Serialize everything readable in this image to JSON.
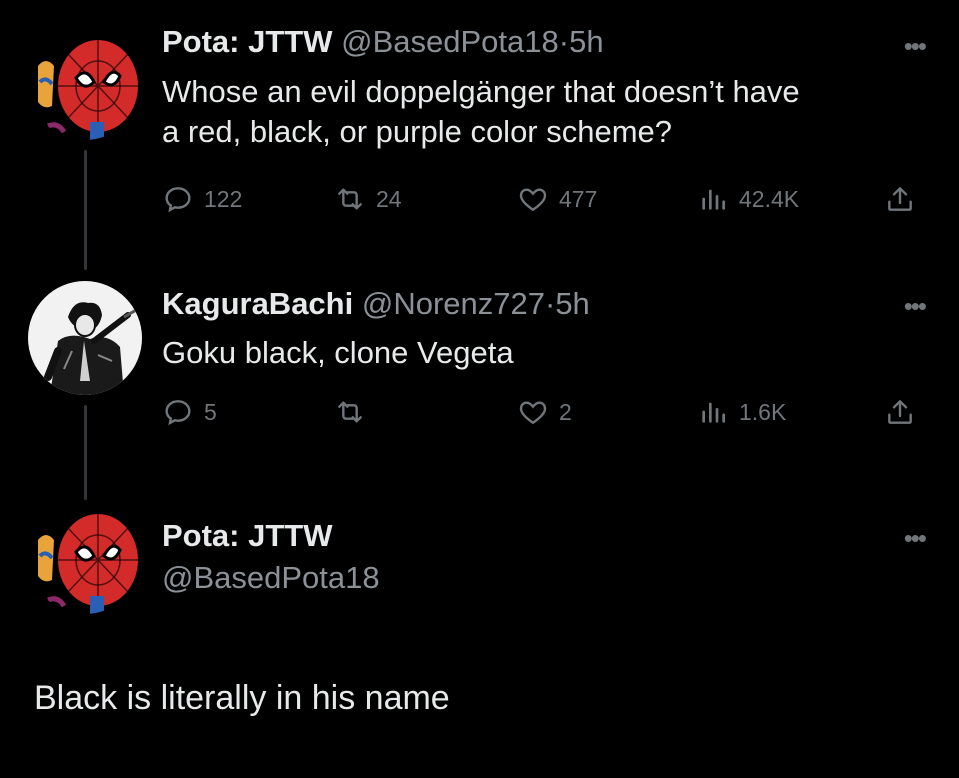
{
  "tweets": [
    {
      "name": "Pota: JTTW",
      "handle": "@BasedPota18",
      "dot": "·",
      "time": "5h",
      "text_lines": [
        "Whose an evil doppelgänger that doesn’t have",
        "a red, black, or purple color scheme?"
      ],
      "stats": {
        "replies": "122",
        "retweets": "24",
        "likes": "477",
        "views": "42.4K"
      },
      "avatar_icon": "spiderman-avatar"
    },
    {
      "name": "KaguraBachi",
      "handle": "@Norenz727",
      "dot": "·",
      "time": "5h",
      "text_lines": [
        "Goku black, clone Vegeta"
      ],
      "stats": {
        "replies": "5",
        "retweets": "",
        "likes": "2",
        "views": "1.6K"
      },
      "avatar_icon": "swordsman-avatar"
    }
  ],
  "final_tweet": {
    "name": "Pota: JTTW",
    "handle": "@BasedPota18",
    "text": "Black is literally in his name",
    "avatar_icon": "spiderman-avatar"
  },
  "more_label": "•••",
  "colors": {
    "background": "#000000",
    "text": "#e7e9ea",
    "muted": "#71767b",
    "spidey_red": "#d32a2a"
  }
}
